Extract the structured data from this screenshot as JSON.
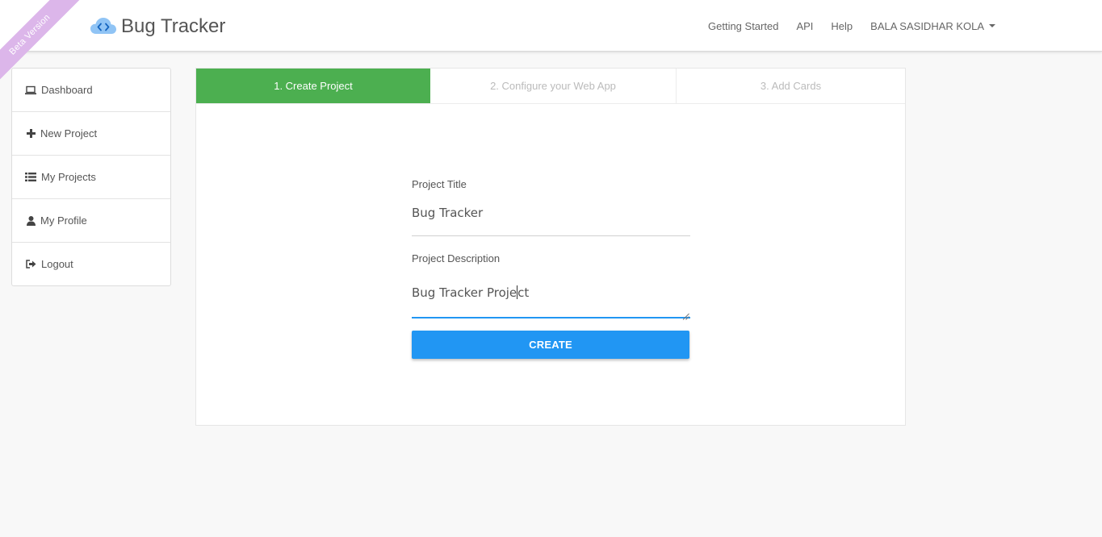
{
  "ribbon": {
    "text": "Beta Version",
    "color": "#dcb6ea"
  },
  "brand": {
    "name": "Bug Tracker",
    "icon": "cloud-code-icon",
    "icon_color": "#90c4f5"
  },
  "nav": {
    "links": [
      {
        "label": "Getting Started"
      },
      {
        "label": "API"
      },
      {
        "label": "Help"
      }
    ],
    "user": {
      "label": "BALA SASIDHAR KOLA",
      "icon": "caret-down-icon"
    }
  },
  "sidebar": {
    "items": [
      {
        "label": "Dashboard",
        "icon": "laptop-icon"
      },
      {
        "label": "New Project",
        "icon": "plus-icon"
      },
      {
        "label": "My Projects",
        "icon": "list-icon"
      },
      {
        "label": "My Profile",
        "icon": "user-icon"
      },
      {
        "label": "Logout",
        "icon": "sign-out-icon"
      }
    ]
  },
  "steps": [
    {
      "label": "1. Create Project",
      "active": true
    },
    {
      "label": "2. Configure your Web App",
      "active": false
    },
    {
      "label": "3. Add Cards",
      "active": false
    }
  ],
  "form": {
    "title_label": "Project Title",
    "title_value": "Bug Tracker",
    "description_label": "Project Description",
    "description_before_cursor": "Bug Tracker Proje",
    "description_after_cursor": "ct",
    "create_button": "CREATE"
  },
  "colors": {
    "active_step": "#4caf50",
    "primary_button": "#2196f3",
    "focus_underline": "#2196f3"
  }
}
